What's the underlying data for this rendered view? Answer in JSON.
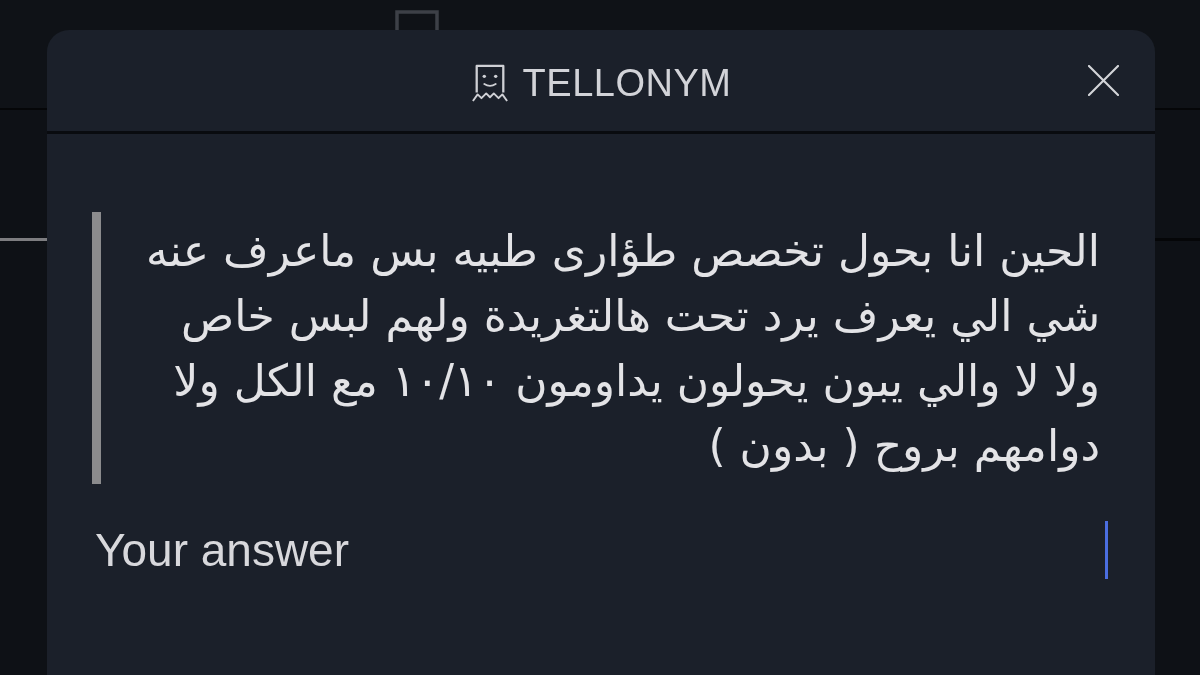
{
  "modal": {
    "title": "TELLONYM",
    "question": "الحين انا بحول تخصص طؤارى طبيه بس ماعرف عنه شي الي يعرف يرد تحت هالتغريدة ولهم لبس خاص ولا لا والي يبون يحولون يداومون ١٠/١٠ مع الكل ولا دوامهم بروح ( بدون )",
    "answer": {
      "placeholder": "Your answer",
      "focused": true
    }
  }
}
